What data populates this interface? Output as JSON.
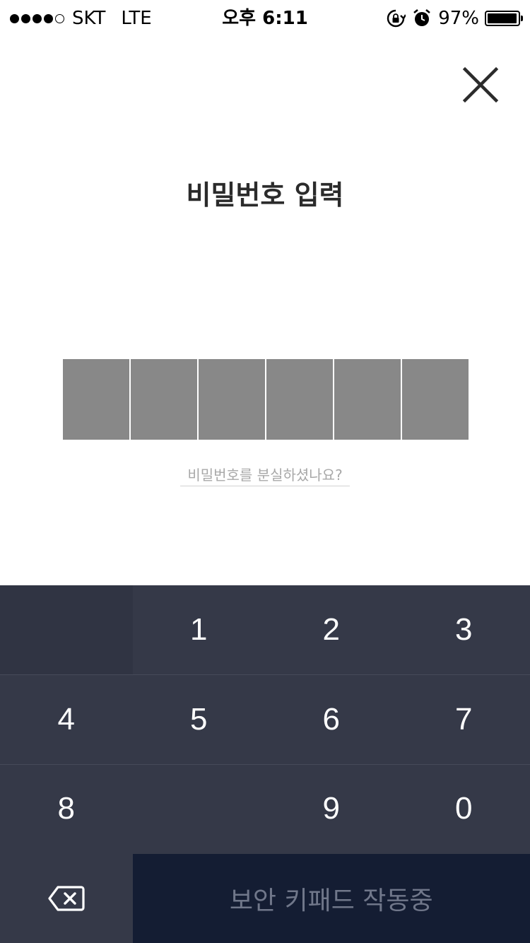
{
  "status_bar": {
    "carrier": "SKT",
    "network": "LTE",
    "time": "오후 6:11",
    "battery": "97%",
    "battery_level": 0.97,
    "signal_bars": 4,
    "icons": [
      "rotation-lock-icon",
      "alarm-icon"
    ]
  },
  "header": {
    "close_icon": "close-icon",
    "title": "비밀번호 입력"
  },
  "pin": {
    "length": 6,
    "box_color": "#888888"
  },
  "forgot_link": "비밀번호를 분실하셨나요?",
  "keypad": {
    "keys": [
      "1",
      "2",
      "3",
      "4",
      "5",
      "6",
      "7",
      "8",
      "9",
      "0"
    ],
    "backspace_icon": "backspace-icon",
    "status_label": "보안 키패드 작동중",
    "colors": {
      "background": "#353948",
      "status_background": "#141d33"
    }
  }
}
